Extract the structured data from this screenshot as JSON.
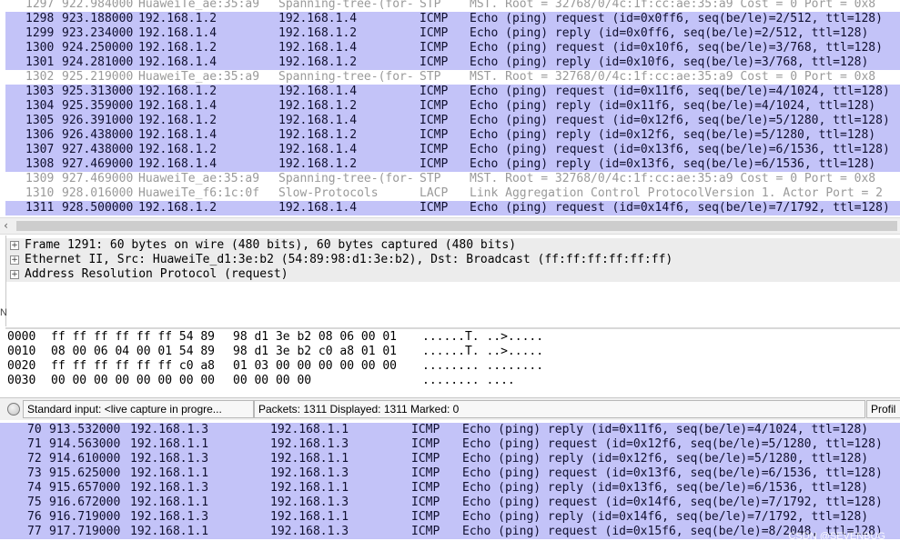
{
  "top_packets": [
    {
      "no": "1297",
      "time": "922.984000",
      "src": "HuaweiTe_ae:35:a9",
      "dst": "Spanning-tree-(for-",
      "proto": "STP",
      "info": "MST. Root = 32768/0/4c:1f:cc:ae:35:a9  Cost = 0  Port = 0x8",
      "kind": "other",
      "clip": true
    },
    {
      "no": "1298",
      "time": "923.188000",
      "src": "192.168.1.2",
      "dst": "192.168.1.4",
      "proto": "ICMP",
      "info": "Echo (ping) request  (id=0x0ff6, seq(be/le)=2/512, ttl=128)",
      "kind": "icmp"
    },
    {
      "no": "1299",
      "time": "923.234000",
      "src": "192.168.1.4",
      "dst": "192.168.1.2",
      "proto": "ICMP",
      "info": "Echo (ping) reply    (id=0x0ff6, seq(be/le)=2/512, ttl=128)",
      "kind": "icmp"
    },
    {
      "no": "1300",
      "time": "924.250000",
      "src": "192.168.1.2",
      "dst": "192.168.1.4",
      "proto": "ICMP",
      "info": "Echo (ping) request  (id=0x10f6, seq(be/le)=3/768, ttl=128)",
      "kind": "icmp"
    },
    {
      "no": "1301",
      "time": "924.281000",
      "src": "192.168.1.4",
      "dst": "192.168.1.2",
      "proto": "ICMP",
      "info": "Echo (ping) reply    (id=0x10f6, seq(be/le)=3/768, ttl=128)",
      "kind": "icmp"
    },
    {
      "no": "1302",
      "time": "925.219000",
      "src": "HuaweiTe_ae:35:a9",
      "dst": "Spanning-tree-(for-",
      "proto": "STP",
      "info": "MST. Root = 32768/0/4c:1f:cc:ae:35:a9  Cost = 0  Port = 0x8",
      "kind": "other"
    },
    {
      "no": "1303",
      "time": "925.313000",
      "src": "192.168.1.2",
      "dst": "192.168.1.4",
      "proto": "ICMP",
      "info": "Echo (ping) request  (id=0x11f6, seq(be/le)=4/1024, ttl=128)",
      "kind": "icmp"
    },
    {
      "no": "1304",
      "time": "925.359000",
      "src": "192.168.1.4",
      "dst": "192.168.1.2",
      "proto": "ICMP",
      "info": "Echo (ping) reply    (id=0x11f6, seq(be/le)=4/1024, ttl=128)",
      "kind": "icmp"
    },
    {
      "no": "1305",
      "time": "926.391000",
      "src": "192.168.1.2",
      "dst": "192.168.1.4",
      "proto": "ICMP",
      "info": "Echo (ping) request  (id=0x12f6, seq(be/le)=5/1280, ttl=128)",
      "kind": "icmp"
    },
    {
      "no": "1306",
      "time": "926.438000",
      "src": "192.168.1.4",
      "dst": "192.168.1.2",
      "proto": "ICMP",
      "info": "Echo (ping) reply    (id=0x12f6, seq(be/le)=5/1280, ttl=128)",
      "kind": "icmp"
    },
    {
      "no": "1307",
      "time": "927.438000",
      "src": "192.168.1.2",
      "dst": "192.168.1.4",
      "proto": "ICMP",
      "info": "Echo (ping) request  (id=0x13f6, seq(be/le)=6/1536, ttl=128)",
      "kind": "icmp"
    },
    {
      "no": "1308",
      "time": "927.469000",
      "src": "192.168.1.4",
      "dst": "192.168.1.2",
      "proto": "ICMP",
      "info": "Echo (ping) reply    (id=0x13f6, seq(be/le)=6/1536, ttl=128)",
      "kind": "icmp"
    },
    {
      "no": "1309",
      "time": "927.469000",
      "src": "HuaweiTe_ae:35:a9",
      "dst": "Spanning-tree-(for-",
      "proto": "STP",
      "info": "MST. Root = 32768/0/4c:1f:cc:ae:35:a9  Cost = 0  Port = 0x8",
      "kind": "other"
    },
    {
      "no": "1310",
      "time": "928.016000",
      "src": "HuaweiTe_f6:1c:0f",
      "dst": "Slow-Protocols",
      "proto": "LACP",
      "info": "Link Aggregation Control ProtocolVersion 1.  Actor Port = 2",
      "kind": "other"
    },
    {
      "no": "1311",
      "time": "928.500000",
      "src": "192.168.1.2",
      "dst": "192.168.1.4",
      "proto": "ICMP",
      "info": "Echo (ping) request  (id=0x14f6, seq(be/le)=7/1792, ttl=128)",
      "kind": "icmp"
    }
  ],
  "details": [
    {
      "text": "Frame 1291: 60 bytes on wire (480 bits), 60 bytes captured (480 bits)",
      "expander": "+"
    },
    {
      "text": "Ethernet II, Src: HuaweiTe_d1:3e:b2 (54:89:98:d1:3e:b2), Dst: Broadcast (ff:ff:ff:ff:ff:ff)",
      "expander": "+"
    },
    {
      "text": "Address Resolution Protocol (request)",
      "expander": "+"
    }
  ],
  "left_edge_fragment": "N",
  "bytes": [
    {
      "offset": "0000",
      "hex1": "ff ff ff ff ff ff 54 89",
      "hex2": "98 d1 3e b2 08 06 00 01",
      "ascii": "......T. ..>....."
    },
    {
      "offset": "0010",
      "hex1": "08 00 06 04 00 01 54 89",
      "hex2": "98 d1 3e b2 c0 a8 01 01",
      "ascii": "......T. ..>....."
    },
    {
      "offset": "0020",
      "hex1": "ff ff ff ff ff ff c0 a8",
      "hex2": "01 03 00 00 00 00 00 00",
      "ascii": "........ ........"
    },
    {
      "offset": "0030",
      "hex1": "00 00 00 00 00 00 00 00",
      "hex2": "00 00 00 00",
      "ascii": "........ ...."
    }
  ],
  "status": {
    "capture_label": "Standard input: <live capture in progre...",
    "packets_label": "Packets: 1311 Displayed: 1311 Marked: 0",
    "profile_label": "Profil"
  },
  "bottom_packets": [
    {
      "no": "70",
      "time": "913.532000",
      "src": "192.168.1.3",
      "dst": "192.168.1.1",
      "proto": "ICMP",
      "info": "Echo (ping) reply    (id=0x11f6, seq(be/le)=4/1024, ttl=128)"
    },
    {
      "no": "71",
      "time": "914.563000",
      "src": "192.168.1.1",
      "dst": "192.168.1.3",
      "proto": "ICMP",
      "info": "Echo (ping) request  (id=0x12f6, seq(be/le)=5/1280, ttl=128)"
    },
    {
      "no": "72",
      "time": "914.610000",
      "src": "192.168.1.3",
      "dst": "192.168.1.1",
      "proto": "ICMP",
      "info": "Echo (ping) reply    (id=0x12f6, seq(be/le)=5/1280, ttl=128)"
    },
    {
      "no": "73",
      "time": "915.625000",
      "src": "192.168.1.1",
      "dst": "192.168.1.3",
      "proto": "ICMP",
      "info": "Echo (ping) request  (id=0x13f6, seq(be/le)=6/1536, ttl=128)"
    },
    {
      "no": "74",
      "time": "915.657000",
      "src": "192.168.1.3",
      "dst": "192.168.1.1",
      "proto": "ICMP",
      "info": "Echo (ping) reply    (id=0x13f6, seq(be/le)=6/1536, ttl=128)"
    },
    {
      "no": "75",
      "time": "916.672000",
      "src": "192.168.1.1",
      "dst": "192.168.1.3",
      "proto": "ICMP",
      "info": "Echo (ping) request  (id=0x14f6, seq(be/le)=7/1792, ttl=128)"
    },
    {
      "no": "76",
      "time": "916.719000",
      "src": "192.168.1.3",
      "dst": "192.168.1.1",
      "proto": "ICMP",
      "info": "Echo (ping) reply    (id=0x14f6, seq(be/le)=7/1792, ttl=128)"
    },
    {
      "no": "77",
      "time": "917.719000",
      "src": "192.168.1.1",
      "dst": "192.168.1.3",
      "proto": "ICMP",
      "info": "Echo (ping) request  (id=0x15f6, seq(be/le)=8/2048, ttl=128)"
    }
  ],
  "watermark": "CSDN @SEVENBUG",
  "colors": {
    "icmp_row": "#c3c3f8",
    "other_row": "#ffffff",
    "other_text": "#9a9a9a",
    "status_bar": "#f0f0f0"
  },
  "icons": {
    "scroll_left": "chevron-left-icon",
    "tree_expander": "plus-box-icon",
    "capture_led": "status-led-icon"
  }
}
